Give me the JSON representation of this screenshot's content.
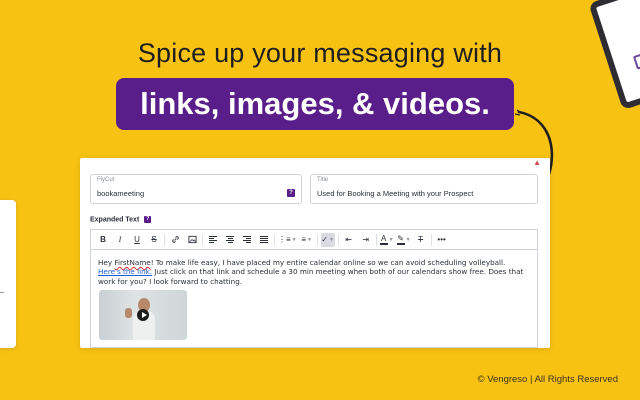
{
  "headline": {
    "line1": "Spice up your messaging with",
    "highlight": "links, images, & videos."
  },
  "editor": {
    "fycut_field": {
      "label": "FlyCut",
      "value": "bookameeting",
      "badge": "?"
    },
    "title_field": {
      "label": "Title",
      "value": "Used for Booking a Meeting with your Prospect"
    },
    "expanded_label": "Expanded Text",
    "expanded_badge": "?",
    "toolbar": {
      "bold": "B",
      "italic": "I",
      "underline": "U",
      "strike": "S",
      "more": "•••"
    },
    "body": {
      "greeting": "Hey ",
      "name_token": "FirstName",
      "text1": "! To make life easy, I have placed my entire calendar online so we can avoid scheduling volleyball. ",
      "link_text": "Here's the link.",
      "text2": " Just click on that link and schedule a 30 min meeting when both of our calendars show free. Does that work for you? I look forward to chatting."
    }
  },
  "footer": "© Vengreso | All Rights Reserved",
  "colors": {
    "background": "#f8c213",
    "accent_purple": "#5a1e8a",
    "link": "#1a5ed8"
  }
}
